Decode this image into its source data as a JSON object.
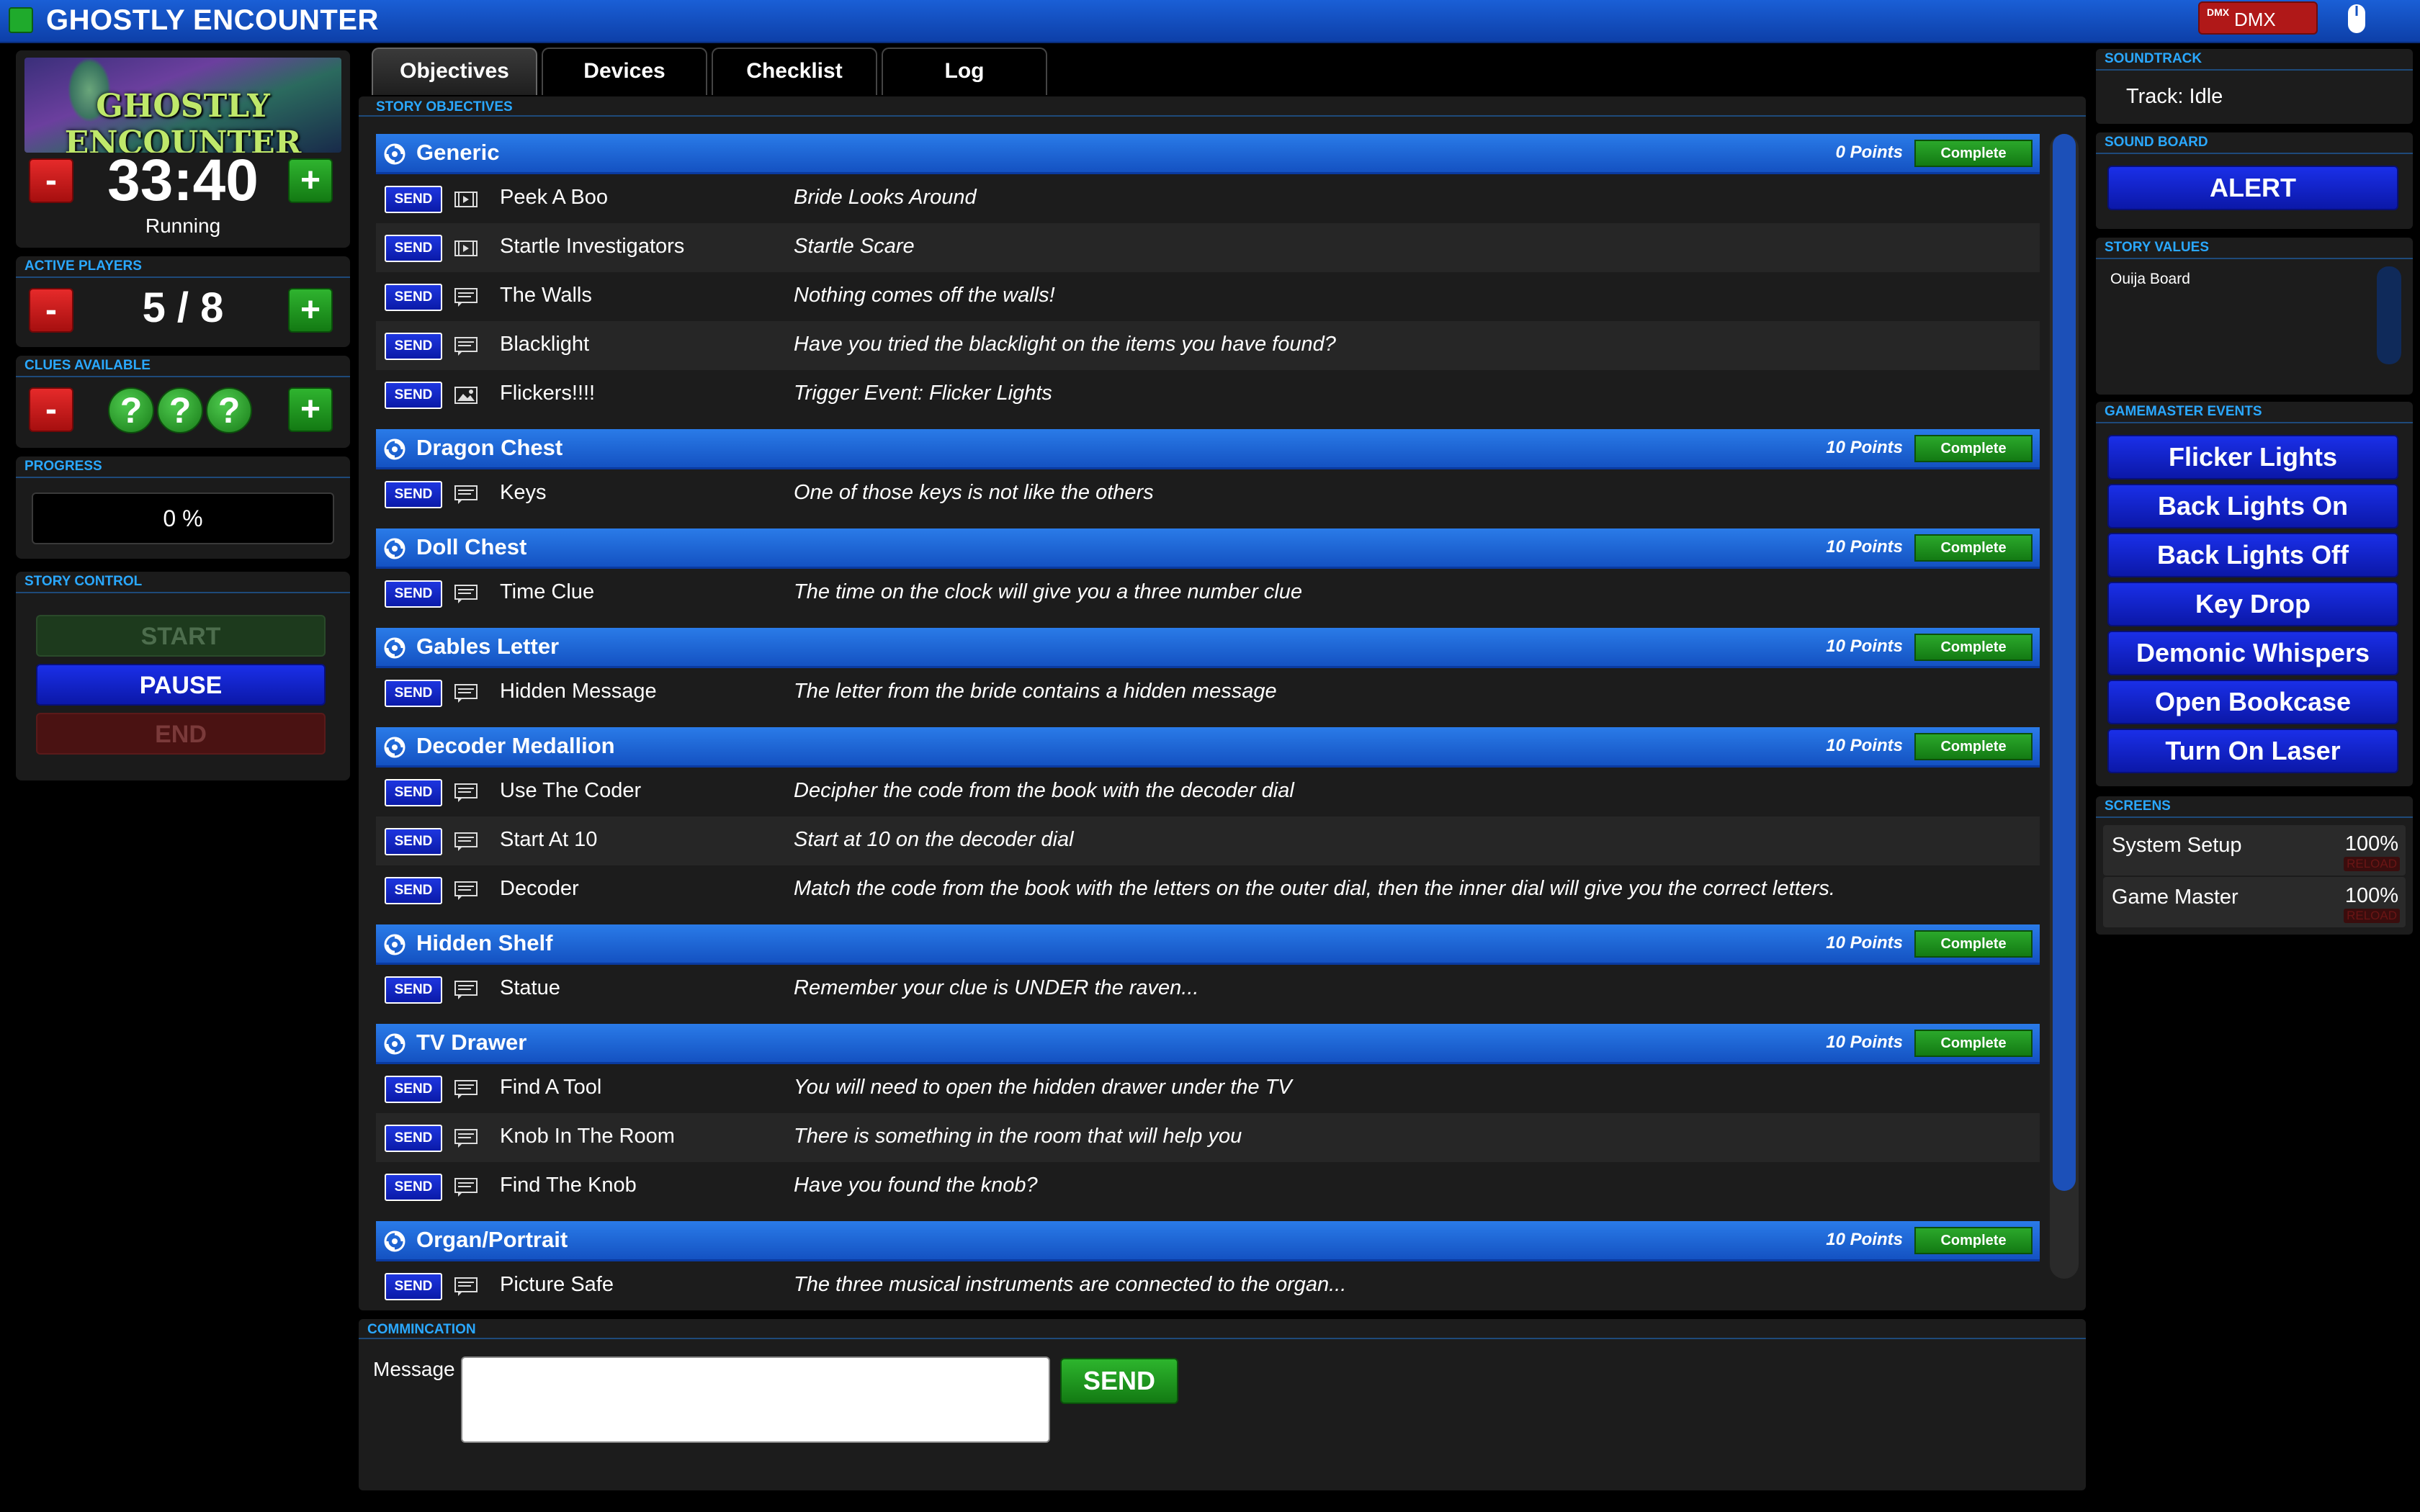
{
  "app": {
    "title": "GHOSTLY ENCOUNTER",
    "dmx_label": "DMX",
    "dmx_icon": "DMX"
  },
  "timer_panel": {
    "logo_text": "GHOSTLY ENCOUNTER",
    "time": "33:40",
    "status": "Running",
    "minus": "-",
    "plus": "+"
  },
  "players_panel": {
    "header": "ACTIVE PLAYERS",
    "count": "5 / 8"
  },
  "clues_panel": {
    "header": "CLUES AVAILABLE",
    "clue_symbol": "?",
    "clue_count": 3
  },
  "progress_panel": {
    "header": "PROGRESS",
    "value": "0 %"
  },
  "story_control": {
    "header": "STORY CONTROL",
    "start": "START",
    "pause": "PAUSE",
    "end": "END"
  },
  "tabs": [
    {
      "label": "Objectives",
      "active": true
    },
    {
      "label": "Devices",
      "active": false
    },
    {
      "label": "Checklist",
      "active": false
    },
    {
      "label": "Log",
      "active": false
    }
  ],
  "objectives": {
    "header": "STORY OBJECTIVES",
    "complete_label": "Complete",
    "send_label": "SEND",
    "groups": [
      {
        "title": "Generic",
        "points": "0 Points",
        "rows": [
          {
            "icon": "video-icon",
            "name": "Peek A Boo",
            "desc": "Bride Looks Around"
          },
          {
            "icon": "video-icon",
            "name": "Startle Investigators",
            "desc": "Startle Scare"
          },
          {
            "icon": "message-icon",
            "name": "The Walls",
            "desc": "Nothing comes off the walls!"
          },
          {
            "icon": "message-icon",
            "name": "Blacklight",
            "desc": "Have you tried the blacklight on the items you have found?"
          },
          {
            "icon": "image-icon",
            "name": "Flickers!!!!",
            "desc": "Trigger Event: Flicker Lights"
          }
        ]
      },
      {
        "title": "Dragon Chest",
        "points": "10 Points",
        "rows": [
          {
            "icon": "message-icon",
            "name": "Keys",
            "desc": "One of those keys is not like the others"
          }
        ]
      },
      {
        "title": "Doll Chest",
        "points": "10 Points",
        "rows": [
          {
            "icon": "message-icon",
            "name": "Time Clue",
            "desc": "The time on the clock will give you a three number clue"
          }
        ]
      },
      {
        "title": "Gables Letter",
        "points": "10 Points",
        "rows": [
          {
            "icon": "message-icon",
            "name": "Hidden Message",
            "desc": "The letter from the bride contains a hidden message"
          }
        ]
      },
      {
        "title": "Decoder Medallion",
        "points": "10 Points",
        "rows": [
          {
            "icon": "message-icon",
            "name": "Use The Coder",
            "desc": "Decipher the code from the book with the decoder dial"
          },
          {
            "icon": "message-icon",
            "name": "Start At 10",
            "desc": "Start at 10 on the decoder dial"
          },
          {
            "icon": "message-icon",
            "name": "Decoder",
            "desc": "Match the code from the book with the letters on the outer dial, then the inner dial will give you the correct letters."
          }
        ]
      },
      {
        "title": "Hidden Shelf",
        "points": "10 Points",
        "rows": [
          {
            "icon": "message-icon",
            "name": "Statue",
            "desc": "Remember your clue is UNDER the raven..."
          }
        ]
      },
      {
        "title": "TV Drawer",
        "points": "10 Points",
        "rows": [
          {
            "icon": "message-icon",
            "name": "Find A Tool",
            "desc": "You will need to open the hidden drawer under the TV"
          },
          {
            "icon": "message-icon",
            "name": "Knob In The Room",
            "desc": "There is something in the room that will help you"
          },
          {
            "icon": "message-icon",
            "name": "Find The Knob",
            "desc": "Have you found the knob?"
          }
        ]
      },
      {
        "title": "Organ/Portrait",
        "points": "10 Points",
        "rows": [
          {
            "icon": "message-icon",
            "name": "Picture Safe",
            "desc": "The three musical instruments are connected to the organ..."
          }
        ]
      }
    ]
  },
  "communication": {
    "header": "COMMINCATION",
    "message_label": "Message",
    "message_value": "",
    "send": "SEND"
  },
  "soundtrack": {
    "header": "SOUNDTRACK",
    "track": "Track: Idle"
  },
  "sound_board": {
    "header": "SOUND BOARD",
    "alert": "ALERT"
  },
  "story_values": {
    "header": "STORY VALUES",
    "items": [
      "Ouija Board"
    ]
  },
  "gamemaster_events": {
    "header": "GAMEMASTER EVENTS",
    "buttons": [
      "Flicker Lights",
      "Back Lights On",
      "Back Lights Off",
      "Key Drop",
      "Demonic Whispers",
      "Open Bookcase",
      "Turn On Laser"
    ]
  },
  "screens": {
    "header": "SCREENS",
    "items": [
      {
        "name": "System Setup",
        "pct": "100%",
        "reload": "RELOAD"
      },
      {
        "name": "Game Master",
        "pct": "100%",
        "reload": "RELOAD"
      }
    ]
  },
  "colors": {
    "accent_blue": "#1452c2",
    "header_cyan": "#2aa8ff",
    "complete_green": "#137a13",
    "minus_red": "#a60f0f"
  }
}
